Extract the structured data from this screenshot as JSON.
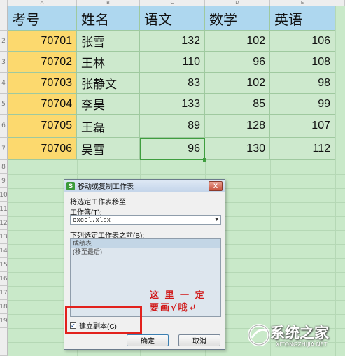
{
  "columns": [
    "A",
    "B",
    "C",
    "D",
    "E"
  ],
  "rows": [
    "2",
    "3",
    "4",
    "5",
    "6",
    "7",
    "8",
    "9",
    "10",
    "11",
    "12",
    "13",
    "14",
    "15",
    "16",
    "17",
    "18",
    "19"
  ],
  "table": {
    "headers": [
      "考号",
      "姓名",
      "语文",
      "数学",
      "英语"
    ],
    "records": [
      [
        "70701",
        "张雪",
        "132",
        "102",
        "106"
      ],
      [
        "70702",
        "王林",
        "110",
        "96",
        "108"
      ],
      [
        "70703",
        "张静文",
        "83",
        "102",
        "98"
      ],
      [
        "70704",
        "李昊",
        "133",
        "85",
        "99"
      ],
      [
        "70705",
        "王磊",
        "89",
        "128",
        "107"
      ],
      [
        "70706",
        "吴雪",
        "96",
        "130",
        "112"
      ]
    ]
  },
  "dialog": {
    "title": "移动或复制工作表",
    "move_label": "将选定工作表移至",
    "workbook_label": "工作簿(T):",
    "workbook_value": "excel.xlsx",
    "before_label": "下列选定工作表之前(B):",
    "sheet_list": [
      "成绩表",
      "(移至最后)"
    ],
    "copy_checkbox_label": "建立副本(C)",
    "copy_checked": true,
    "ok_label": "确定",
    "cancel_label": "取消",
    "close_glyph": "X",
    "icon_letter": "S"
  },
  "annotation": {
    "line1": "这 里 一 定",
    "line2": "要画√哦↵",
    "color": "#e2211c"
  },
  "watermark": {
    "text": "系统之家",
    "url": "XITONGZHIJIA.NET"
  },
  "colors": {
    "sheet_bg": "#c9e9c9",
    "header_bg": "#aed7ef",
    "id_bg": "#fcd96e"
  }
}
